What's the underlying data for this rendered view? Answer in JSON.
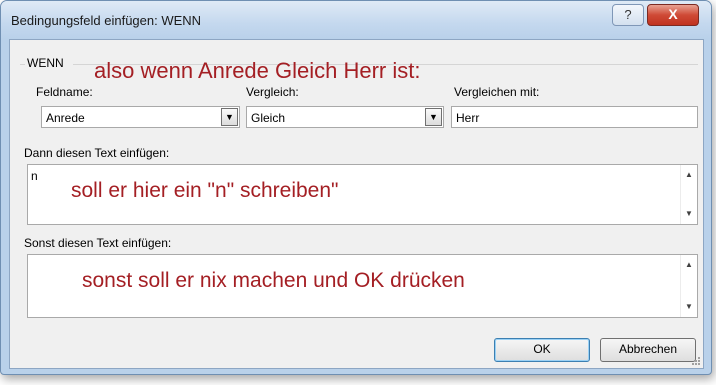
{
  "window": {
    "title": "Bedingungsfeld einfügen: WENN",
    "help_label": "?",
    "close_label": "X"
  },
  "group": {
    "label": "WENN"
  },
  "fields": {
    "feldname": {
      "label": "Feldname:",
      "value": "Anrede"
    },
    "vergleich": {
      "label": "Vergleich:",
      "value": "Gleich"
    },
    "vergleichen_mit": {
      "label": "Vergleichen mit:",
      "value": "Herr"
    }
  },
  "dann": {
    "label": "Dann diesen Text einfügen:",
    "value": "n"
  },
  "sonst": {
    "label": "Sonst diesen Text einfügen:",
    "value": ""
  },
  "buttons": {
    "ok": "OK",
    "cancel": "Abbrechen"
  },
  "annotations": {
    "top": "also wenn Anrede Gleich Herr ist:",
    "middle": "soll er hier ein \"n\" schreiben\"",
    "bottom": "sonst soll er nix machen und OK drücken"
  },
  "icons": {
    "dropdown": "chevron-down-icon",
    "scroll_up": "scroll-up-icon",
    "scroll_down": "scroll-down-icon"
  },
  "colors": {
    "annotation": "#a41f24",
    "window_frame": "#b9d1ea",
    "close_button": "#c0321f"
  }
}
